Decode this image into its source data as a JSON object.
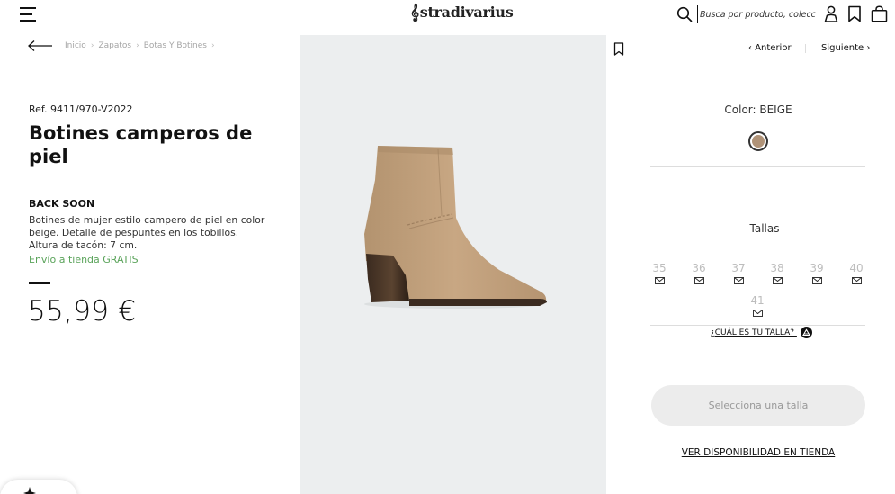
{
  "header": {
    "logo": "stradivarius",
    "search_placeholder": "Busca por producto, colección..."
  },
  "breadcrumb": [
    "Inicio",
    "Zapatos",
    "Botas Y Botines"
  ],
  "product": {
    "ref": "Ref. 9411/970-V2022",
    "title": "Botines camperos de piel",
    "status": "BACK SOON",
    "description": "Botines de mujer estilo campero de piel en color beige. Detalle de pespuntes en los tobillos. Altura de tacón: 7 cm.",
    "shipping": "Envío a tienda GRATIS",
    "price": "55,99 €"
  },
  "navigation": {
    "prev": "Anterior",
    "next": "Siguiente"
  },
  "color": {
    "label": "Color: BEIGE",
    "swatch_hex": "#b09378"
  },
  "sizes": {
    "label": "Tallas",
    "items": [
      "35",
      "36",
      "37",
      "38",
      "39",
      "40",
      "41"
    ]
  },
  "size_guide": "¿CUÁL ES TU TALLA?",
  "select_size_button": "Selecciona una talla",
  "store_availability": "VER DISPONIBILIDAD EN TIENDA",
  "colors": {
    "shipping_green": "#5aa35a",
    "image_background": "#eceeef",
    "size_disabled": "#bdbdbd"
  }
}
